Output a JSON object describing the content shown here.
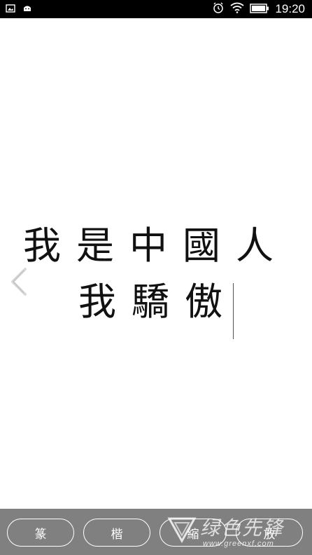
{
  "status_bar": {
    "time": "19:20",
    "icons": [
      "image-notification-icon",
      "android-notification-icon",
      "alarm-icon",
      "wifi-icon",
      "battery-icon"
    ]
  },
  "content": {
    "calligraphy_line_1": "我是中國人",
    "calligraphy_line_2": "我驕傲",
    "prev_icon": "chevron-left-icon"
  },
  "toolbar": {
    "buttons": [
      {
        "label": "篆"
      },
      {
        "label": "楷"
      },
      {
        "label": "縮"
      },
      {
        "label": "放"
      }
    ]
  },
  "watermark": {
    "brand": "绿色先锋",
    "url": "www.greenxf.com"
  }
}
